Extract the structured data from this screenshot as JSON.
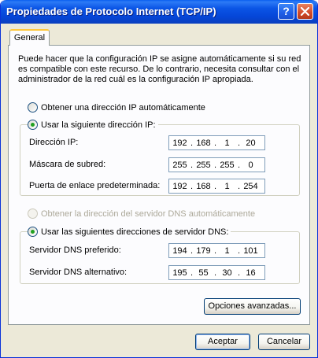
{
  "window": {
    "title": "Propiedades de Protocolo Internet (TCP/IP)",
    "help_button": "?"
  },
  "tabs": [
    {
      "label": "General"
    }
  ],
  "intro_text": "Puede hacer que la configuración IP se asigne automáticamente si su red es compatible con este recurso. De lo contrario, necesita consultar con el administrador de la red cuál es la configuración IP apropiada.",
  "ip": {
    "auto_label": "Obtener una dirección IP automáticamente",
    "manual_label": "Usar la siguiente dirección IP:",
    "selected": "manual",
    "fields": [
      {
        "label": "Dirección IP:",
        "octets": [
          "192",
          "168",
          "1",
          "20"
        ]
      },
      {
        "label": "Máscara de subred:",
        "octets": [
          "255",
          "255",
          "255",
          "0"
        ]
      },
      {
        "label": "Puerta de enlace predeterminada:",
        "octets": [
          "192",
          "168",
          "1",
          "254"
        ]
      }
    ]
  },
  "dns": {
    "auto_label": "Obtener la dirección del servidor DNS automáticamente",
    "manual_label": "Usar las siguientes direcciones de servidor DNS:",
    "selected": "manual",
    "fields": [
      {
        "label": "Servidor DNS preferido:",
        "octets": [
          "194",
          "179",
          "1",
          "101"
        ]
      },
      {
        "label": "Servidor DNS alternativo:",
        "octets": [
          "195",
          "55",
          "30",
          "16"
        ]
      }
    ]
  },
  "buttons": {
    "advanced": "Opciones avanzadas...",
    "ok": "Aceptar",
    "cancel": "Cancelar"
  },
  "colors": {
    "titlebar": "#0a55e4",
    "dialog_bg": "#ece9d8",
    "panel_bg": "#fcfcfe",
    "tab_highlight": "#ffc83c",
    "radio_dot": "#21a121"
  }
}
